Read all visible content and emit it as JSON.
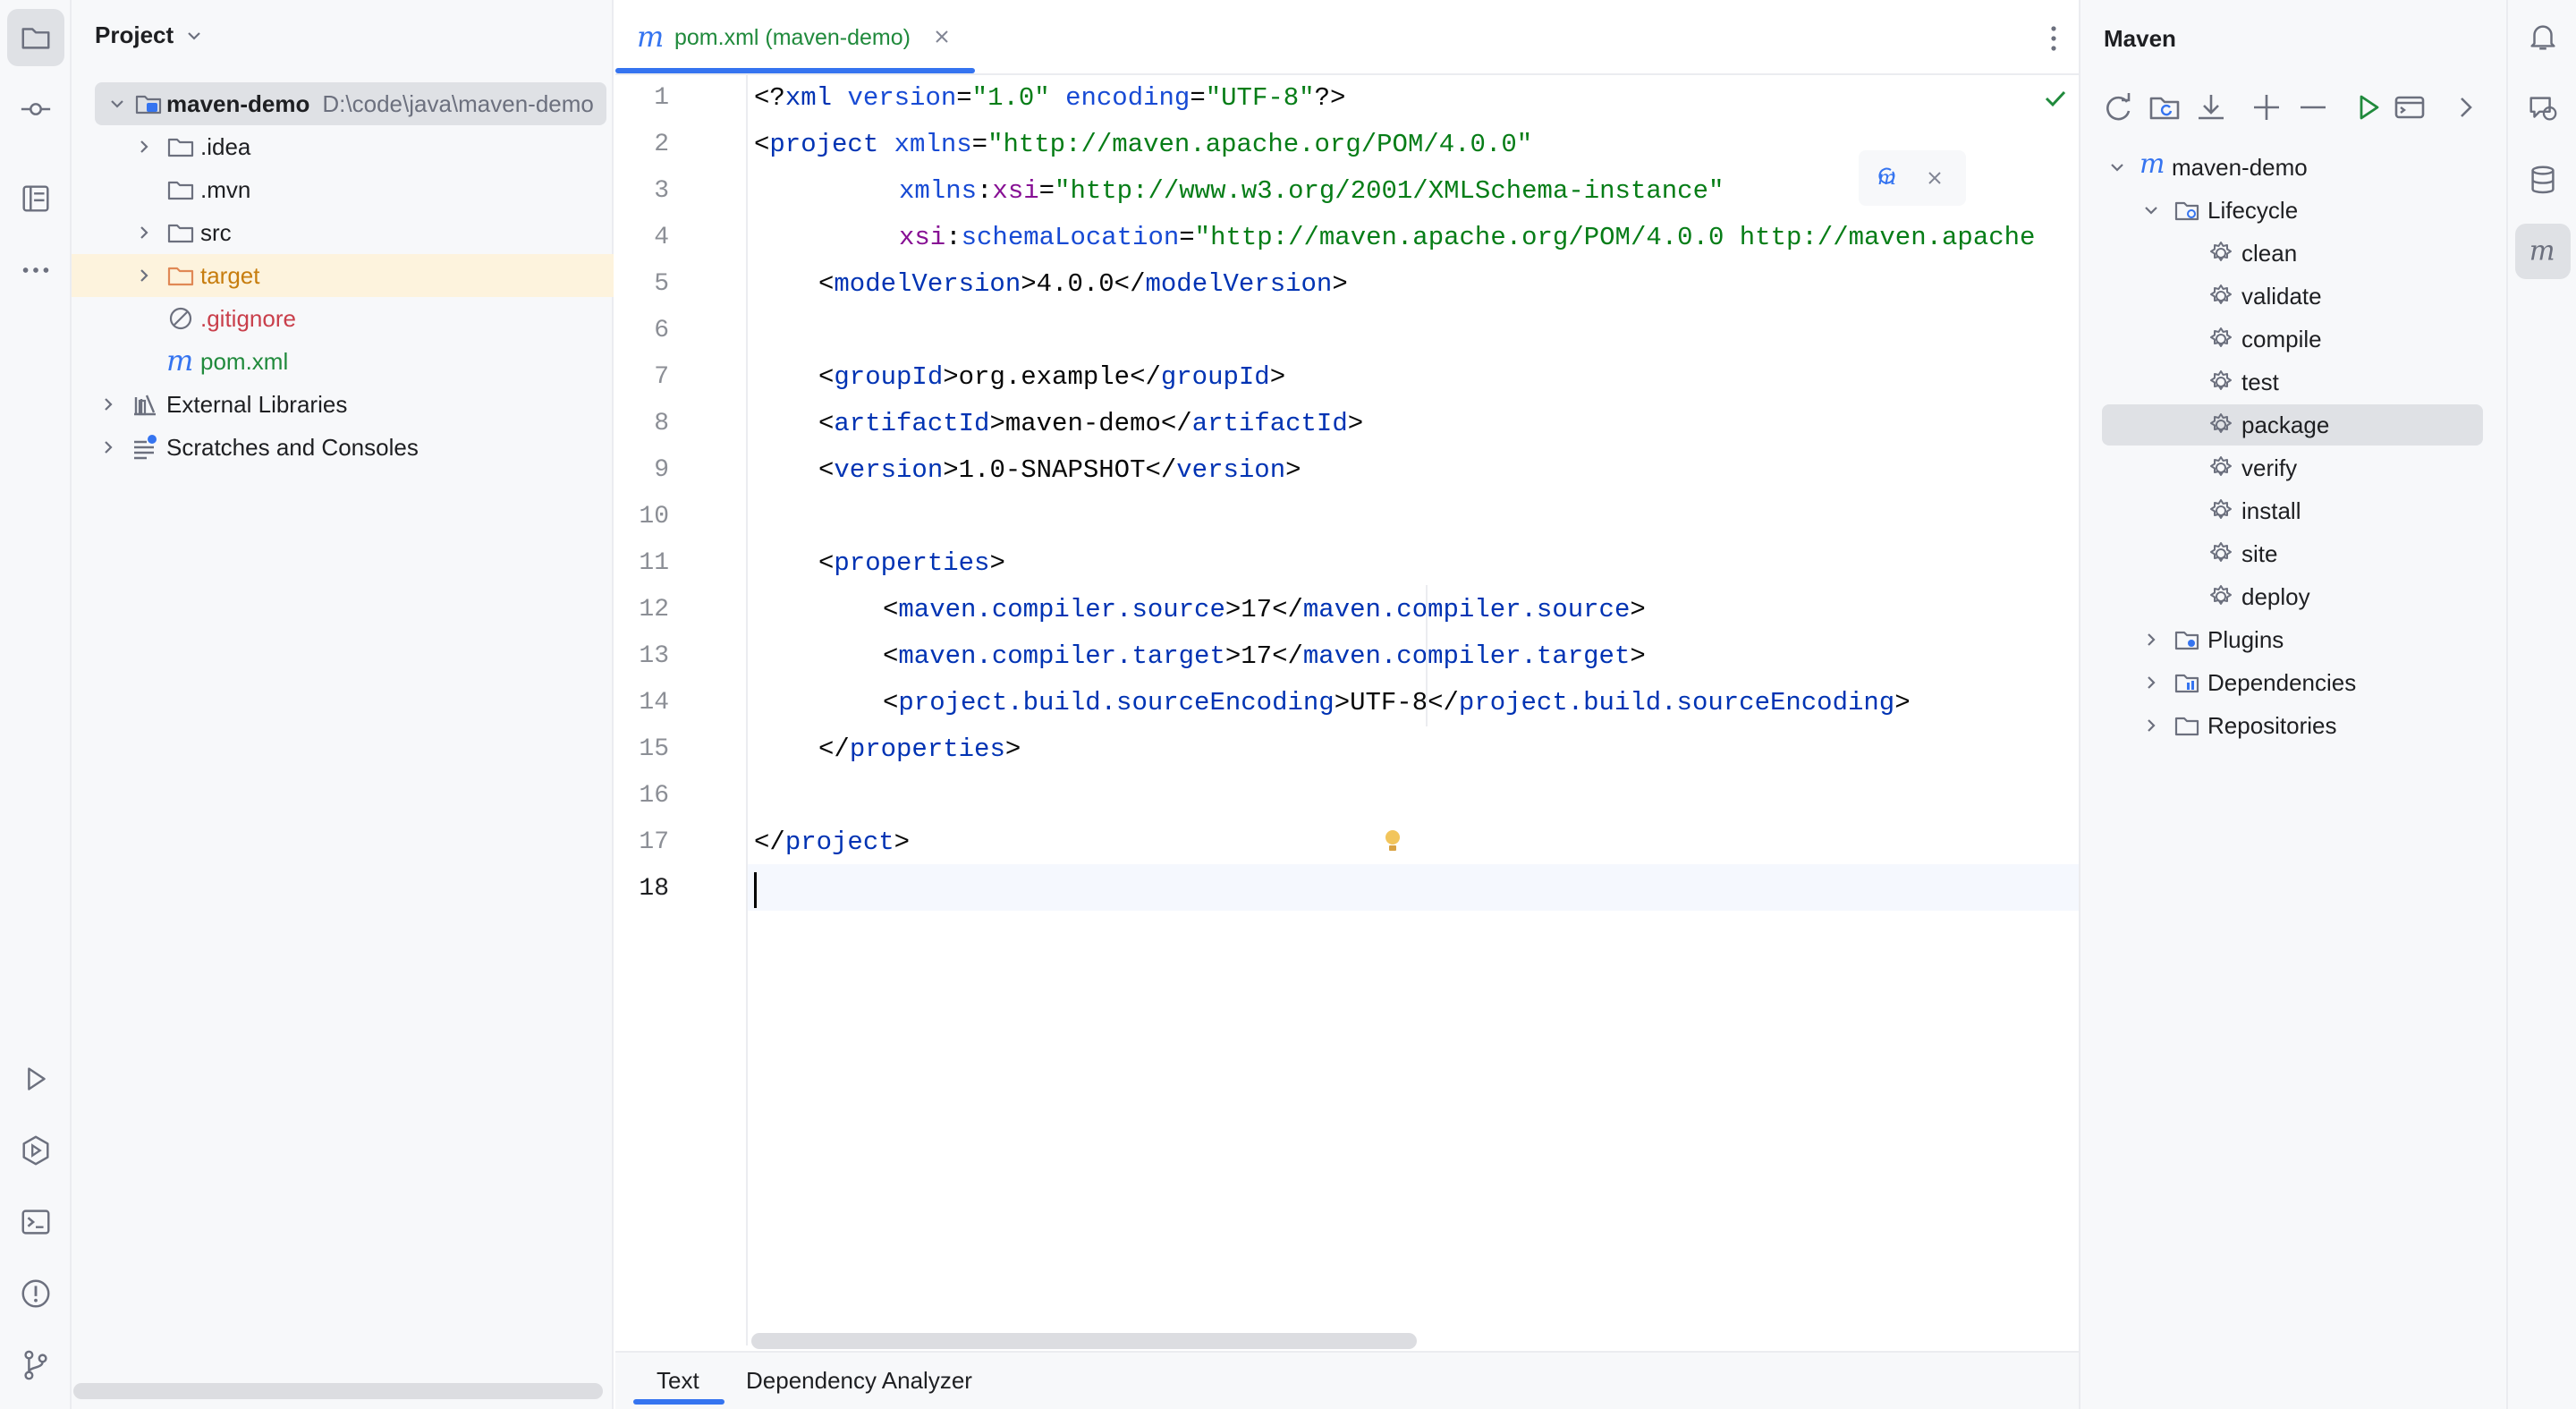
{
  "project_panel": {
    "title": "Project",
    "tree": [
      {
        "label": "maven-demo",
        "path": "D:\\code\\java\\maven-demo"
      },
      {
        "label": ".idea"
      },
      {
        "label": ".mvn"
      },
      {
        "label": "src"
      },
      {
        "label": "target"
      },
      {
        "label": ".gitignore"
      },
      {
        "label": "pom.xml"
      },
      {
        "label": "External Libraries"
      },
      {
        "label": "Scratches and Consoles"
      }
    ]
  },
  "editor": {
    "tab_label": "pom.xml (maven-demo)",
    "line_numbers": [
      "1",
      "2",
      "3",
      "4",
      "5",
      "6",
      "7",
      "8",
      "9",
      "10",
      "11",
      "12",
      "13",
      "14",
      "15",
      "16",
      "17",
      "18"
    ],
    "code": {
      "l1": [
        "<?",
        "xml ",
        "version",
        "=",
        "\"1.0\"",
        " ",
        "encoding",
        "=",
        "\"UTF-8\"",
        "?>"
      ],
      "l2": [
        "<",
        "project ",
        "xmlns",
        "=",
        "\"http://maven.apache.org/POM/4.0.0\""
      ],
      "l3": [
        "xmlns",
        ":",
        "xsi",
        "=",
        "\"http://www.w3.org/2001/XMLSchema-instance\""
      ],
      "l4": [
        "xsi",
        ":",
        "schemaLocation",
        "=",
        "\"http://maven.apache.org/POM/4.0.0 http://maven.apache"
      ],
      "l5": [
        "<",
        "modelVersion",
        ">4.0.0</",
        "modelVersion",
        ">"
      ],
      "l7": [
        "<",
        "groupId",
        ">org.example</",
        "groupId",
        ">"
      ],
      "l8": [
        "<",
        "artifactId",
        ">maven-demo</",
        "artifactId",
        ">"
      ],
      "l9": [
        "<",
        "version",
        ">1.0-SNAPSHOT</",
        "version",
        ">"
      ],
      "l11": [
        "<",
        "properties",
        ">"
      ],
      "l12": [
        "<",
        "maven.compiler.source",
        ">17</",
        "maven.compiler.source",
        ">"
      ],
      "l13": [
        "<",
        "maven.compiler.target",
        ">17</",
        "maven.compiler.target",
        ">"
      ],
      "l14": [
        "<",
        "project.build.sourceEncoding",
        ">UTF-8</",
        "project.build.sourceEncoding",
        ">"
      ],
      "l15": [
        "</",
        "properties",
        ">"
      ],
      "l17": [
        "</",
        "project",
        ">"
      ]
    },
    "bottom_tabs": [
      "Text",
      "Dependency Analyzer"
    ]
  },
  "maven_panel": {
    "title": "Maven",
    "root": "maven-demo",
    "lifecycle_label": "Lifecycle",
    "phases": [
      "clean",
      "validate",
      "compile",
      "test",
      "package",
      "verify",
      "install",
      "site",
      "deploy"
    ],
    "groups": [
      "Plugins",
      "Dependencies",
      "Repositories"
    ],
    "selected_phase": "package"
  },
  "colors": {
    "accent": "#3574f0",
    "tag": "#0033b3",
    "string": "#067d17",
    "modified_file": "#208a3c",
    "ignored_file": "#c93f4b",
    "excluded_folder": "#c77d0e"
  }
}
